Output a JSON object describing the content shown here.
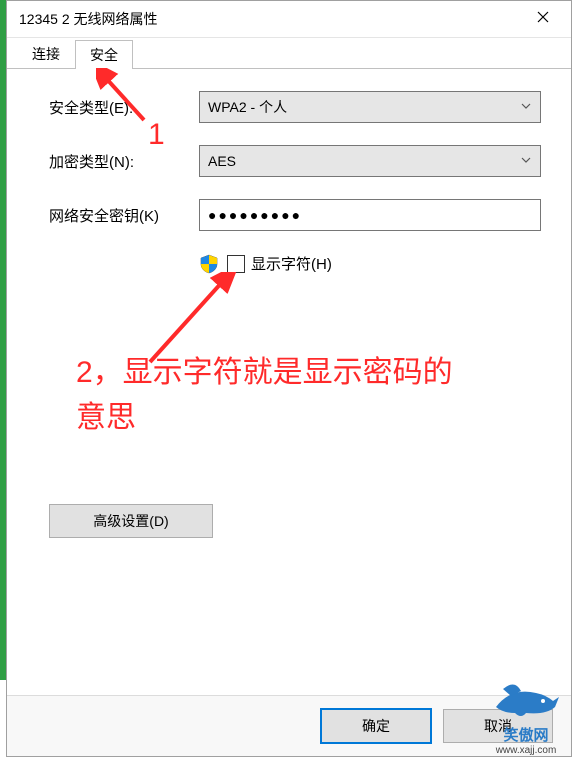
{
  "window": {
    "title": "12345 2 无线网络属性"
  },
  "tabs": {
    "connect": "连接",
    "security": "安全"
  },
  "labels": {
    "security_type": "安全类型(E):",
    "encryption_type": "加密类型(N):",
    "network_key": "网络安全密钥(K)",
    "show_chars": "显示字符(H)"
  },
  "fields": {
    "security_type_value": "WPA2 - 个人",
    "encryption_type_value": "AES",
    "network_key_value": "●●●●●●●●●"
  },
  "buttons": {
    "advanced": "高级设置(D)",
    "ok": "确定",
    "cancel": "取消"
  },
  "annotations": {
    "a1": "1",
    "a2_line1": "2，显示字符就是显示密码的",
    "a2_line2": "意思"
  },
  "watermark": {
    "line1": "笑傲网",
    "line2": "www.xajj.com"
  }
}
